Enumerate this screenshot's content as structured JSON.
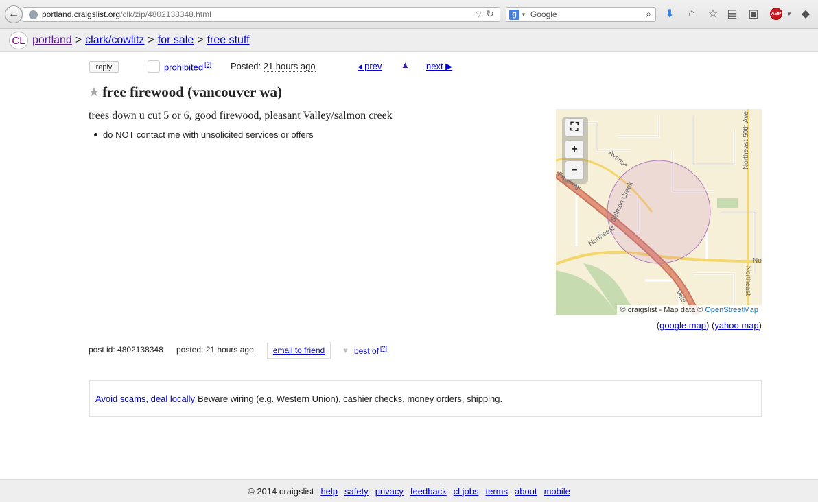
{
  "browser": {
    "url_host": "portland.craigslist.org",
    "url_path": "/clk/zip/4802138348.html",
    "search_placeholder": "Google",
    "search_engine_badge": "g",
    "adblock_label": "ABP"
  },
  "breadcrumb": {
    "logo": "CL",
    "items": [
      "portland",
      "clark/cowlitz",
      "for sale",
      "free stuff"
    ],
    "separator": ">"
  },
  "postnav": {
    "reply": "reply",
    "prohibited": "prohibited",
    "help_mark": "[?]",
    "posted_label": "Posted:",
    "posted_time": "21 hours ago",
    "prev": "◂ prev",
    "up": "▲",
    "next": "next ▶"
  },
  "post": {
    "title": "free firewood (vancouver wa)",
    "body": "trees down u cut 5 or 6, good firewood, pleasant Valley/salmon creek",
    "notice": "do NOT contact me with unsolicited services or offers"
  },
  "map": {
    "attribution_prefix": "© craigslist - Map data ©",
    "attribution_link": "OpenStreetMap",
    "labels": {
      "freeway": "Freeway",
      "avenue": "Avenue",
      "salmon_creek": "Salmon Creek",
      "northeast": "Northeast",
      "northeast_50th": "Northeast 50th Ave",
      "northeast_right": "Northeast",
      "no": "No",
      "vete": "Vete"
    },
    "zoom_in": "+",
    "zoom_out": "–",
    "fullscreen": "⛶"
  },
  "maplinks": {
    "open": "(",
    "google": "google map",
    "mid": ") (",
    "yahoo": "yahoo map",
    "close": ")"
  },
  "postinfo": {
    "post_id_label": "post id: 4802138348",
    "posted_label": "posted:",
    "posted_time": "21 hours ago",
    "email": "email to friend",
    "bestof": "best of",
    "help_mark": "[?]"
  },
  "scam": {
    "link": "Avoid scams, deal locally",
    "text": "Beware wiring (e.g. Western Union), cashier checks, money orders, shipping."
  },
  "footer": {
    "copyright": "© 2014 craigslist",
    "links": [
      "help",
      "safety",
      "privacy",
      "feedback",
      "cl jobs",
      "terms",
      "about",
      "mobile"
    ]
  }
}
